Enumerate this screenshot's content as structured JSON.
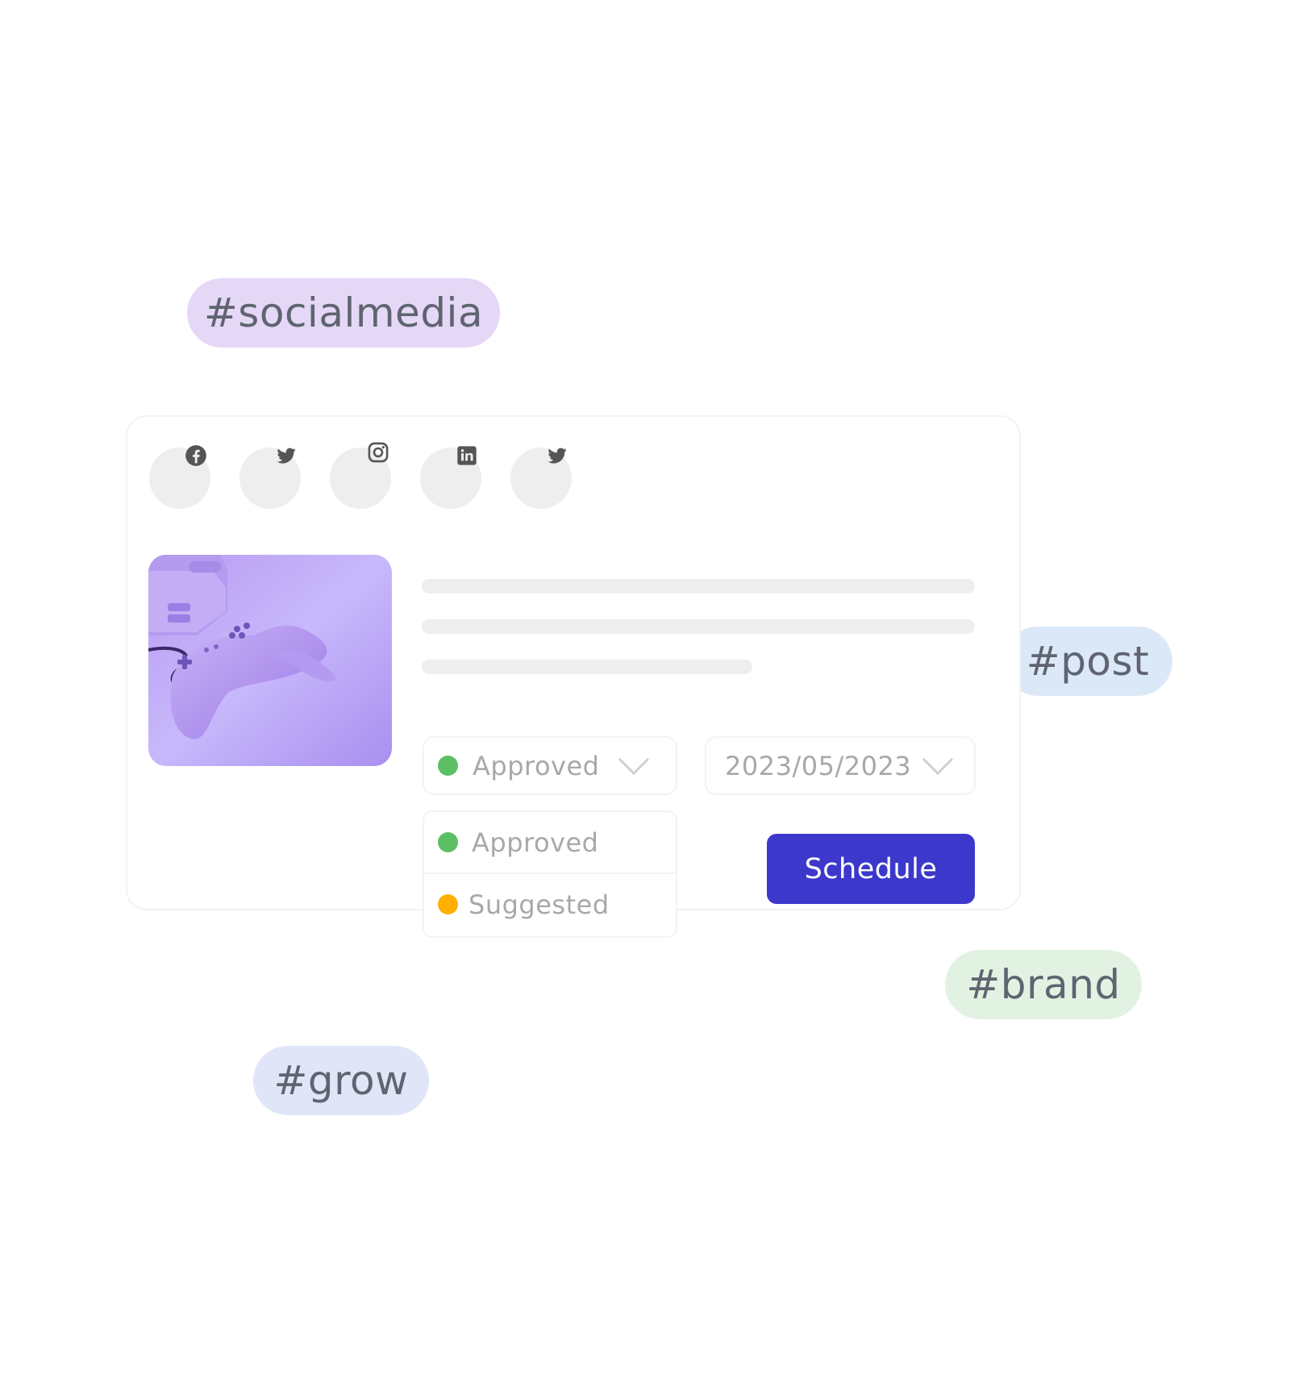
{
  "tags": {
    "socialmedia": "#socialmedia",
    "post": "#post",
    "brand": "#brand",
    "grow": "#grow"
  },
  "networks": [
    "facebook-icon",
    "twitter-icon",
    "instagram-icon",
    "linkedin-icon",
    "twitter-icon"
  ],
  "status_select": {
    "value": "Approved",
    "dot_color": "#5cbf66"
  },
  "date_select": {
    "value": "2023/05/2023"
  },
  "status_options": [
    {
      "label": "Approved",
      "dot_color": "#5cbf66"
    },
    {
      "label": "Suggested",
      "dot_color": "#ffb000"
    }
  ],
  "schedule_button": "Schedule",
  "colors": {
    "accent": "#3c38cc",
    "approved": "#5cbf66",
    "suggested": "#ffb000"
  }
}
